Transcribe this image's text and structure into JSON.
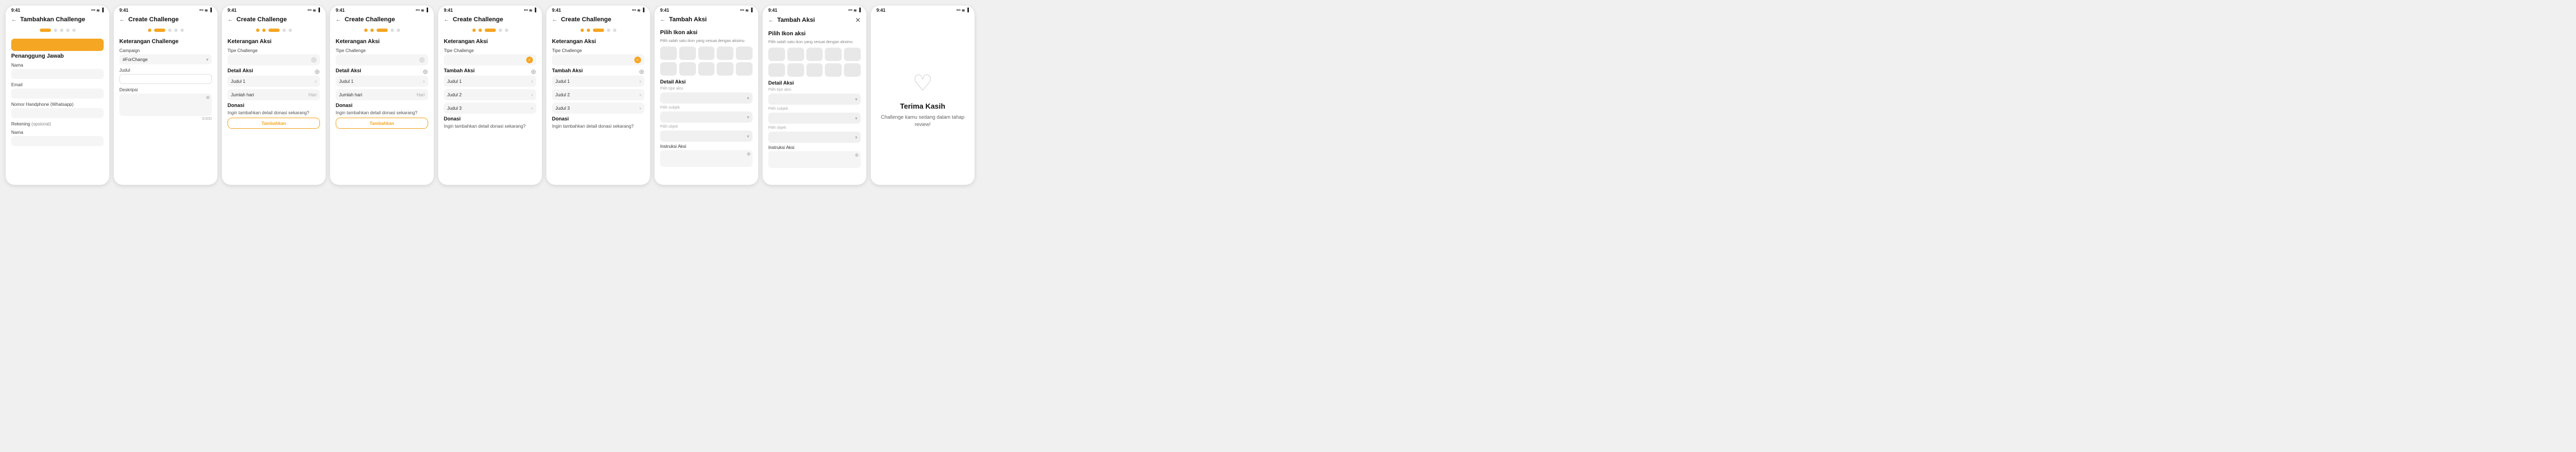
{
  "screens": [
    {
      "id": "screen1",
      "time": "9:41",
      "header_title": "Tambahkan Challenge",
      "has_back": true,
      "has_close": false,
      "progress": [
        1,
        0,
        0,
        0,
        0
      ],
      "section_title": "Penanggung Jawab",
      "fields": [
        {
          "label": "Nama",
          "type": "input_empty"
        },
        {
          "label": "Email",
          "type": "input_empty"
        },
        {
          "label": "Nomor Handphone (Whatsapp)",
          "type": "input_empty"
        },
        {
          "label": "Rekening (opsional)",
          "sublabel": "Nama",
          "type": "rekening"
        }
      ]
    },
    {
      "id": "screen2",
      "time": "9:41",
      "header_title": "Create Challenge",
      "has_back": true,
      "has_close": false,
      "progress": [
        1,
        1,
        0,
        0,
        0
      ],
      "section_title": "Keterangan Challenge",
      "fields": [
        {
          "label": "Campaign",
          "type": "select",
          "value": "#ForChange"
        },
        {
          "label": "Judul",
          "type": "input_empty"
        },
        {
          "label": "Deskripsi",
          "type": "textarea"
        }
      ]
    },
    {
      "id": "screen3",
      "time": "9:41",
      "header_title": "Create Challenge",
      "has_back": true,
      "has_close": false,
      "progress": [
        1,
        1,
        1,
        0,
        0
      ],
      "section_title": "Keterangan Aksi",
      "tipe_challenge_empty": true,
      "detail_aksi_title": "Detail Aksi",
      "actions": [
        {
          "label": "Judul 1",
          "has_chevron": true
        },
        {
          "label": "Jumlah hari",
          "suffix": "Hari",
          "has_chevron": false
        }
      ],
      "donasi_title": "Donasi",
      "donasi_text": "Ingin tambahkan detail donasi sekarang?",
      "donasi_btn": "Tambahkan"
    },
    {
      "id": "screen4",
      "time": "9:41",
      "header_title": "Create Challenge",
      "has_back": true,
      "has_close": false,
      "progress": [
        1,
        1,
        1,
        0,
        0
      ],
      "section_title": "Keterangan Aksi",
      "tipe_challenge_empty": true,
      "detail_aksi_title": "Detail Aksi",
      "actions": [
        {
          "label": "Judul 1",
          "has_chevron": true
        },
        {
          "label": "Jumlah hari",
          "suffix": "Hari",
          "has_chevron": false
        }
      ],
      "donasi_title": "Donasi",
      "donasi_text": "Ingin tambahkan detail donasi sekarang?",
      "donasi_btn": "Tambahkan"
    },
    {
      "id": "screen5",
      "time": "9:41",
      "header_title": "Create Challenge",
      "has_back": true,
      "has_close": false,
      "progress": [
        1,
        1,
        1,
        0,
        0
      ],
      "section_title": "Keterangan Aksi",
      "tipe_challenge_has_circle": true,
      "tambah_aksi_title": "Tambah Aksi",
      "actions_multi": [
        {
          "label": "Judul 1"
        },
        {
          "label": "Judul 2"
        },
        {
          "label": "Judul 3"
        }
      ],
      "donasi_title": "Donasi",
      "donasi_text": "Ingin tambahkan detail donasi sekarang?"
    },
    {
      "id": "screen6",
      "time": "9:41",
      "header_title": "Create Challenge",
      "has_back": true,
      "has_close": false,
      "progress": [
        1,
        1,
        1,
        0,
        0
      ],
      "section_title": "Keterangan Aksi",
      "tipe_challenge_has_circle": true,
      "tambah_aksi_title": "Tambah Aksi",
      "actions_multi": [
        {
          "label": "Judul 1"
        },
        {
          "label": "Judul 2"
        },
        {
          "label": "Judul 3"
        }
      ],
      "donasi_title": "Donasi",
      "donasi_text": "Ingin tambahkan detail donasi sekarang?"
    },
    {
      "id": "screen7",
      "time": "9:41",
      "header_title": "Tambah Aksi",
      "has_back": true,
      "has_close": false,
      "pilih_ikon_title": "Pilih Ikon aksi",
      "pilih_ikon_sub": "Pilih salah satu ikon yang sesuai dengan aksimu",
      "icon_count": 10,
      "detail_aksi_title": "Detail Aksi",
      "detail_fields": [
        {
          "label": "Pilih tipe aksi",
          "type": "dropdown"
        },
        {
          "label": "Pilih subjek",
          "type": "dropdown"
        },
        {
          "label": "Pilih objek",
          "type": "dropdown"
        }
      ],
      "instruksi_label": "Instruksi Aksi"
    },
    {
      "id": "screen8",
      "time": "9:41",
      "header_title": "Tambah Aksi",
      "has_back": true,
      "has_close": true,
      "pilih_ikon_title": "Pilih Ikon aksi",
      "pilih_ikon_sub": "Pilih salah satu ikon yang sesuai dengan aksimu",
      "icon_count": 10,
      "detail_aksi_title": "Detail Aksi",
      "detail_fields": [
        {
          "label": "Pilih tipe aksi",
          "type": "dropdown"
        },
        {
          "label": "Pilih subjek",
          "type": "dropdown"
        },
        {
          "label": "Pilih objek",
          "type": "dropdown"
        }
      ],
      "instruksi_label": "Instruksi Aksi"
    },
    {
      "id": "screen9",
      "time": "9:41",
      "is_thank_you": true,
      "heart_icon": "♡",
      "title": "Terima Kasih",
      "subtitle": "Challenge kamu sedang dalam\ntahap review!"
    }
  ]
}
